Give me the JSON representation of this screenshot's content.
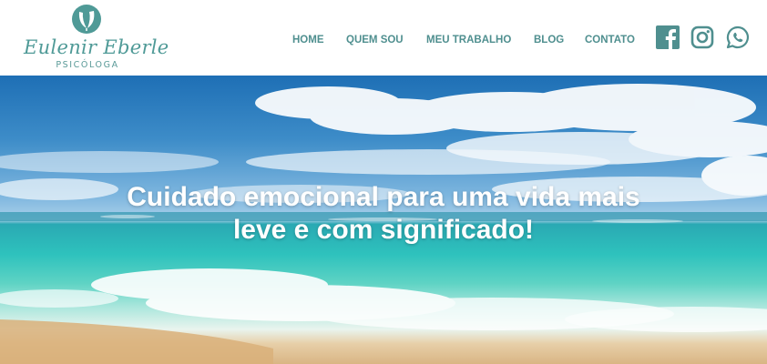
{
  "brand": {
    "name": "Eulenir Eberle",
    "subtitle": "PSICÓLOGA",
    "color": "#4f9a97"
  },
  "nav": {
    "items": [
      {
        "label": "HOME"
      },
      {
        "label": "QUEM SOU"
      },
      {
        "label": "MEU TRABALHO"
      },
      {
        "label": "BLOG"
      },
      {
        "label": "CONTATO"
      }
    ],
    "color": "#4f8f8f"
  },
  "social": {
    "icons": [
      "facebook-icon",
      "instagram-icon",
      "whatsapp-icon"
    ],
    "color": "#4f8f8f"
  },
  "hero": {
    "title_line1": "Cuidado emocional para uma vida mais",
    "title_line2": "leve e com significado!"
  }
}
